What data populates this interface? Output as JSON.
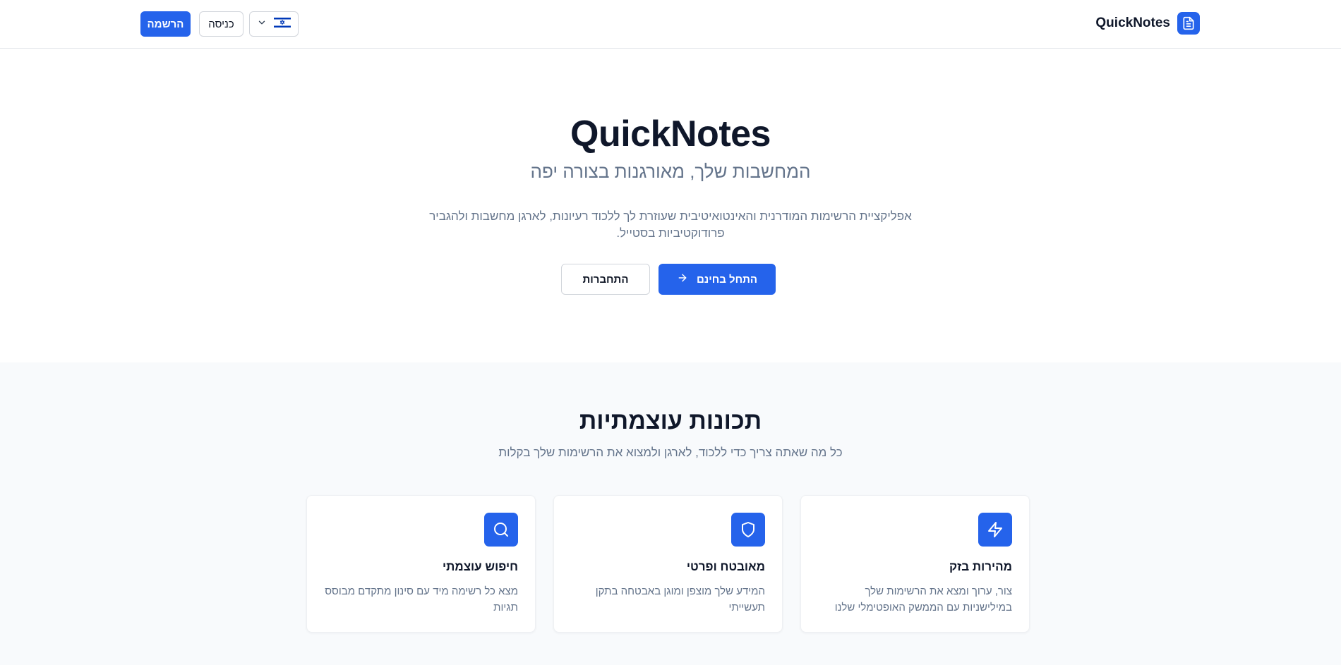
{
  "header": {
    "brand": "QuickNotes",
    "signup_label": "הרשמה",
    "login_label": "כניסה",
    "language": {
      "flag": "israel-flag-icon"
    }
  },
  "hero": {
    "title": "QuickNotes",
    "subtitle": "המחשבות שלך, מאורגנות בצורה יפה",
    "description": "אפליקציית הרשימות המודרנית והאינטואיטיבית שעוזרת לך ללכוד רעיונות, לארגן מחשבות ולהגביר פרודוקטיביות בסטייל.",
    "primary_cta": "התחל בחינם",
    "secondary_cta": "התחברות"
  },
  "features": {
    "title": "תכונות עוצמתיות",
    "subtitle": "כל מה שאתה צריך כדי ללכוד, לארגן ולמצוא את הרשימות שלך בקלות",
    "cards": [
      {
        "icon": "lightning-icon",
        "title": "מהירות בזק",
        "text": "צור, ערוך ומצא את הרשימות שלך במילישניות עם הממשק האופטימלי שלנו"
      },
      {
        "icon": "shield-icon",
        "title": "מאובטח ופרטי",
        "text": "המידע שלך מוצפן ומוגן באבטחה בתקן תעשייתי"
      },
      {
        "icon": "search-icon",
        "title": "חיפוש עוצמתי",
        "text": "מצא כל רשימה מיד עם סינון מתקדם מבוסס תגיות"
      }
    ]
  },
  "colors": {
    "accent": "#2563eb",
    "text": "#0f172a",
    "muted": "#64748b",
    "section_bg": "#f8fafc"
  }
}
